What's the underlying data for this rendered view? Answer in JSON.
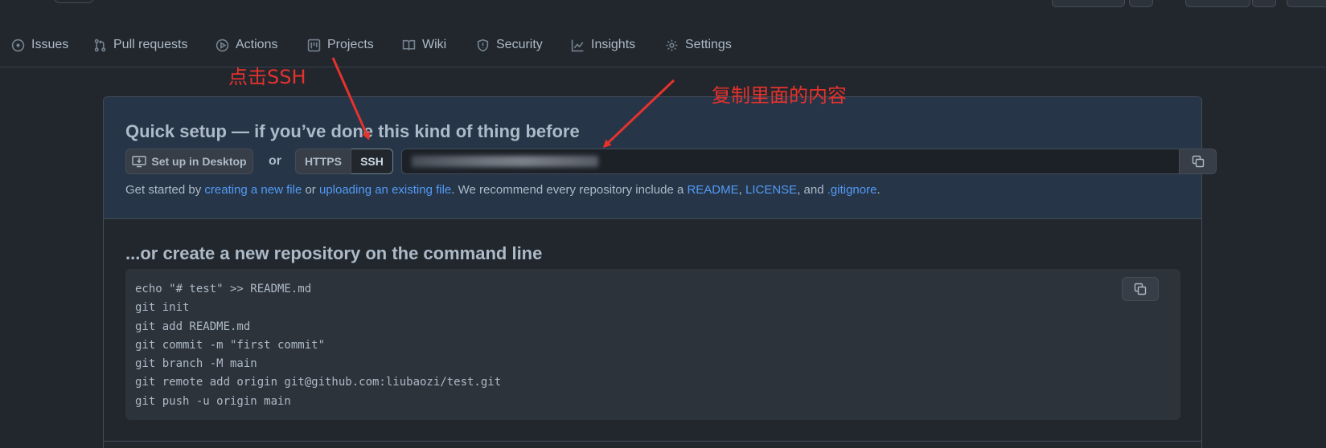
{
  "nav": {
    "items": [
      {
        "label": "Issues",
        "icon": "issue-icon"
      },
      {
        "label": "Pull requests",
        "icon": "pull-request-icon"
      },
      {
        "label": "Actions",
        "icon": "play-icon"
      },
      {
        "label": "Projects",
        "icon": "project-icon"
      },
      {
        "label": "Wiki",
        "icon": "book-icon"
      },
      {
        "label": "Security",
        "icon": "shield-icon"
      },
      {
        "label": "Insights",
        "icon": "graph-icon"
      },
      {
        "label": "Settings",
        "icon": "gear-icon"
      }
    ]
  },
  "quick_setup": {
    "title": "Quick setup — if you’ve done this kind of thing before",
    "desktop_button": "Set up in Desktop",
    "or_text": "or",
    "protocols": {
      "https": "HTTPS",
      "ssh": "SSH"
    },
    "selected_protocol": "SSH",
    "url_value": "",
    "desc": {
      "prefix": "Get started by ",
      "link1": "creating a new file",
      "mid1": " or ",
      "link2": "uploading an existing file",
      "mid2": ". We recommend every repository include a ",
      "link3": "README",
      "sep1": ", ",
      "link4": "LICENSE",
      "sep2": ", and ",
      "link5": ".gitignore",
      "suffix": "."
    }
  },
  "command_line": {
    "title": "...or create a new repository on the command line",
    "lines": [
      "echo \"# test\" >> README.md",
      "git init",
      "git add README.md",
      "git commit -m \"first commit\"",
      "git branch -M main",
      "git remote add origin git@github.com:liubaozi/test.git",
      "git push -u origin main"
    ]
  },
  "annotations": {
    "click_ssh": "点击SSH",
    "copy_content": "复制里面的内容"
  },
  "colors": {
    "background": "#22272e",
    "link": "#539bf5",
    "annotation": "#e5322d"
  }
}
